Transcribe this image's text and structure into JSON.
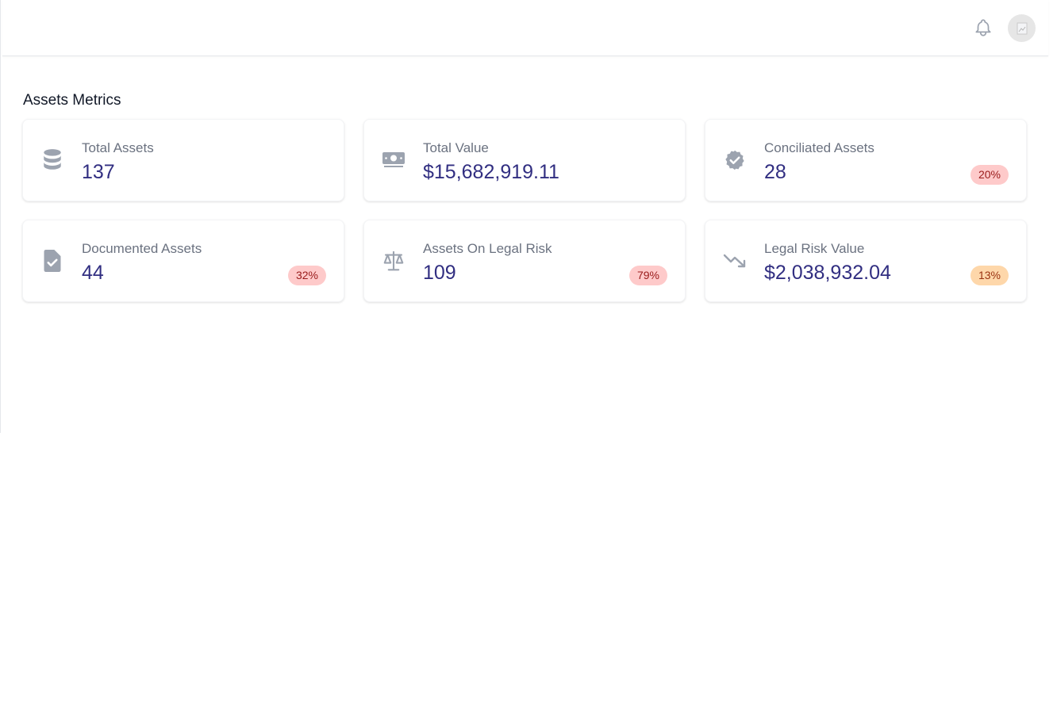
{
  "header": {
    "notifications_icon": "bell-icon",
    "avatar_icon": "user-avatar-placeholder"
  },
  "section": {
    "title": "Assets Metrics"
  },
  "colors": {
    "value_text": "#312e81",
    "label_text": "#6b7280",
    "icon": "#9ca3af",
    "badge_red_bg": "#fecaca",
    "badge_red_text": "#991b1b",
    "badge_orange_bg": "#fed7aa",
    "badge_orange_text": "#9a3412"
  },
  "metrics": [
    {
      "icon": "database-icon",
      "label": "Total Assets",
      "value": "137",
      "badge": ""
    },
    {
      "icon": "cash-icon",
      "label": "Total Value",
      "value": "$15,682,919.11",
      "badge": ""
    },
    {
      "icon": "verified-badge-icon",
      "label": "Conciliated Assets",
      "value": "28",
      "badge": "20%"
    },
    {
      "icon": "document-check-icon",
      "label": "Documented Assets",
      "value": "44",
      "badge": "32%"
    },
    {
      "icon": "scale-icon",
      "label": "Assets On Legal Risk",
      "value": "109",
      "badge": "79%"
    },
    {
      "icon": "trending-down-icon",
      "label": "Legal Risk Value",
      "value": "$2,038,932.04",
      "badge": "13%"
    }
  ]
}
